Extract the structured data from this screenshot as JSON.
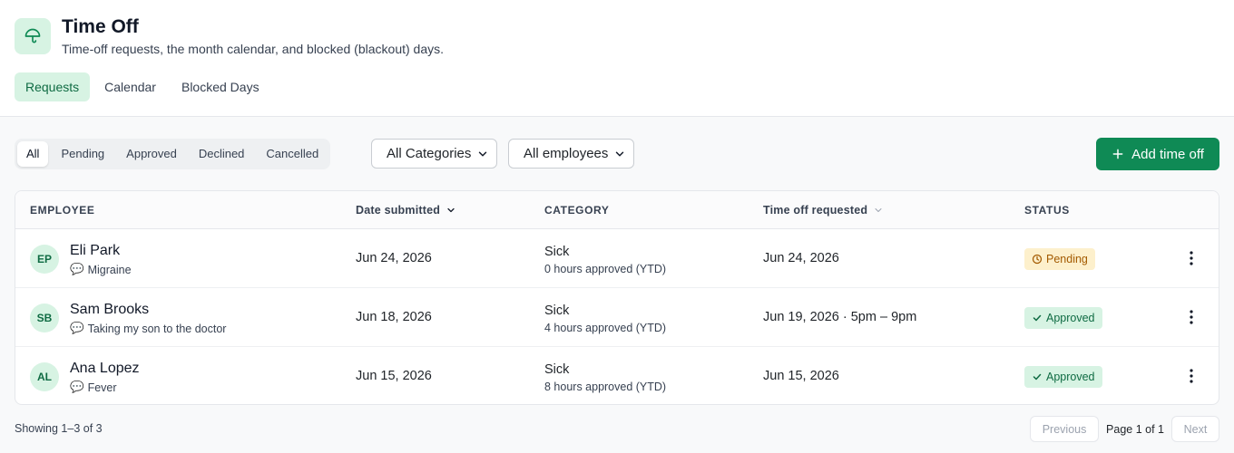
{
  "header": {
    "title": "Time Off",
    "subtitle": "Time-off requests, the month calendar, and blocked (blackout) days.",
    "icon": "umbrella-icon",
    "tabs": [
      {
        "label": "Requests",
        "active": true
      },
      {
        "label": "Calendar",
        "active": false
      },
      {
        "label": "Blocked Days",
        "active": false
      }
    ]
  },
  "filters": {
    "status": [
      {
        "label": "All",
        "active": true
      },
      {
        "label": "Pending",
        "active": false
      },
      {
        "label": "Approved",
        "active": false
      },
      {
        "label": "Declined",
        "active": false
      },
      {
        "label": "Cancelled",
        "active": false
      }
    ],
    "category_select": "All Categories",
    "employee_select": "All employees",
    "add_label": "Add time off"
  },
  "table": {
    "columns": {
      "employee": "EMPLOYEE",
      "date_submitted": "Date submitted",
      "category": "CATEGORY",
      "time_off_requested": "Time off requested",
      "status": "STATUS"
    },
    "rows": [
      {
        "initials": "EP",
        "name": "Eli Park",
        "note": "Migraine",
        "date_submitted": "Jun 24, 2026",
        "category": "Sick",
        "hours": "0 hours approved (YTD)",
        "requested": "Jun 24, 2026",
        "status": "Pending",
        "status_type": "pending"
      },
      {
        "initials": "SB",
        "name": "Sam Brooks",
        "note": "Taking my son to the doctor",
        "date_submitted": "Jun 18, 2026",
        "category": "Sick",
        "hours": "4 hours approved (YTD)",
        "requested": "Jun 19, 2026 · 5pm – 9pm",
        "status": "Approved",
        "status_type": "approved"
      },
      {
        "initials": "AL",
        "name": "Ana Lopez",
        "note": "Fever",
        "date_submitted": "Jun 15, 2026",
        "category": "Sick",
        "hours": "8 hours approved (YTD)",
        "requested": "Jun 15, 2026",
        "status": "Approved",
        "status_type": "approved"
      }
    ]
  },
  "footer": {
    "showing": "Showing 1–3 of 3",
    "previous": "Previous",
    "page": "Page 1 of 1",
    "next": "Next"
  },
  "colors": {
    "accent": "#0f8a55",
    "accent_light": "#d7f3e3",
    "pending_bg": "#fdf0cc",
    "pending_fg": "#a35a00"
  }
}
